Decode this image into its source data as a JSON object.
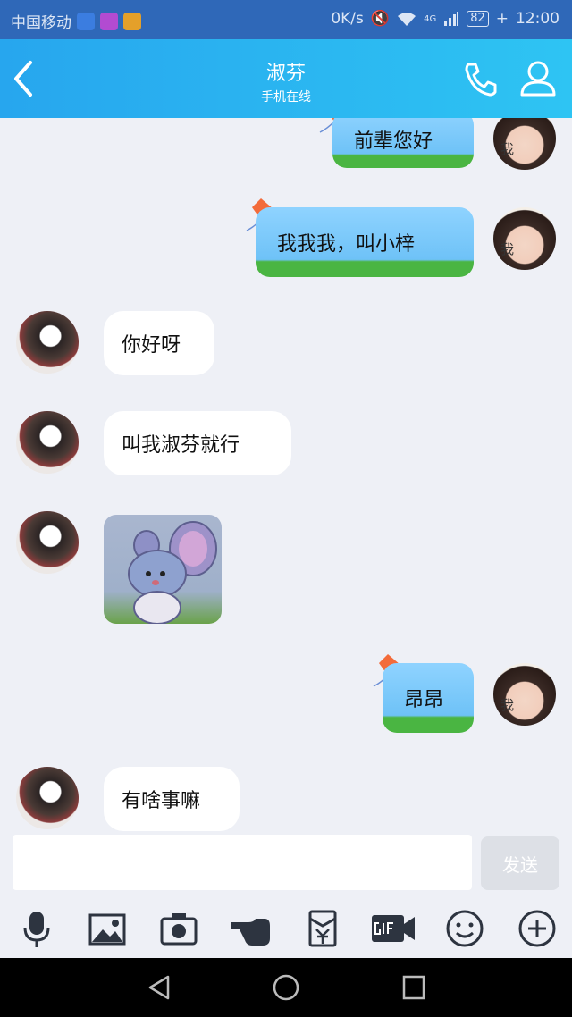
{
  "status_bar": {
    "carrier": "中国移动",
    "network_speed": "0K/s",
    "signal": "4G",
    "battery": "82",
    "time": "12:00"
  },
  "header": {
    "title": "淑芬",
    "subtitle": "手机在线"
  },
  "messages": [
    {
      "sender": "me",
      "text": "前辈您好"
    },
    {
      "sender": "me",
      "text": "我我我，叫小梓"
    },
    {
      "sender": "her",
      "text": "你好呀"
    },
    {
      "sender": "her",
      "text": "叫我淑芬就行"
    },
    {
      "sender": "her",
      "type": "sticker"
    },
    {
      "sender": "me",
      "text": "昂昂"
    },
    {
      "sender": "her",
      "text": "有啥事嘛"
    }
  ],
  "avatar_me_label": "我",
  "input": {
    "value": "",
    "send_label": "发送"
  },
  "toolbar_icons": [
    "mic-icon",
    "image-icon",
    "camera-icon",
    "poke-icon",
    "red-packet-icon",
    "gif-icon",
    "emoji-icon",
    "plus-icon"
  ],
  "colors": {
    "header_start": "#27a6ee",
    "header_end": "#2ec4f3",
    "status_bar": "#2f68b8",
    "chat_background": "#eef0f6"
  }
}
